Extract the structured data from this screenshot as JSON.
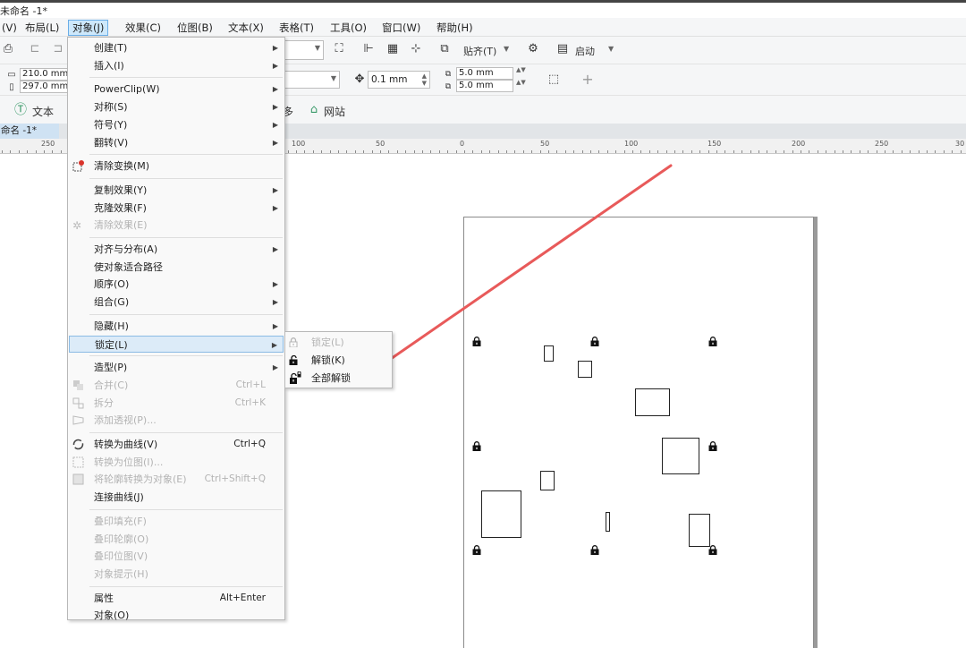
{
  "window": {
    "title": "未命名 -1*"
  },
  "menubar": {
    "items": [
      "(V)",
      "布局(L)",
      "对象(J)",
      "效果(C)",
      "位图(B)",
      "文本(X)",
      "表格(T)",
      "工具(O)",
      "窗口(W)",
      "帮助(H)"
    ]
  },
  "toolbar1": {
    "snap_label": "贴齐(T)",
    "launch_label": "启动"
  },
  "toolbar2": {
    "width": "210.0 mm",
    "height": "297.0 mm",
    "nudge": "0.1 mm",
    "dup_x": "5.0 mm",
    "dup_y": "5.0 mm"
  },
  "toolbar3": {
    "text_label": "文本",
    "website_label": "网站",
    "partial_char": "多"
  },
  "document_tab": {
    "label": "命名 -1*"
  },
  "ruler": {
    "labels": [
      "250",
      "100",
      "50",
      "0",
      "50",
      "100",
      "150",
      "200",
      "250",
      "30"
    ]
  },
  "object_menu": {
    "groups": [
      [
        {
          "label": "创建(T)",
          "submenu": true
        },
        {
          "label": "插入(I)",
          "submenu": true
        }
      ],
      [
        {
          "label": "PowerClip(W)",
          "submenu": true
        },
        {
          "label": "对称(S)",
          "submenu": true
        },
        {
          "label": "符号(Y)",
          "submenu": true
        },
        {
          "label": "翻转(V)",
          "submenu": true
        }
      ],
      [
        {
          "label": "清除变换(M)",
          "icon": "clear-transform-icon"
        }
      ],
      [
        {
          "label": "复制效果(Y)",
          "submenu": true
        },
        {
          "label": "克隆效果(F)",
          "submenu": true
        },
        {
          "label": "清除效果(E)",
          "disabled": true,
          "icon": "clear-effect-icon"
        }
      ],
      [
        {
          "label": "对齐与分布(A)",
          "submenu": true
        },
        {
          "label": "使对象适合路径"
        },
        {
          "label": "顺序(O)",
          "submenu": true
        },
        {
          "label": "组合(G)",
          "submenu": true
        }
      ],
      [
        {
          "label": "隐藏(H)",
          "submenu": true
        },
        {
          "label": "锁定(L)",
          "submenu": true,
          "highlighted": true
        }
      ],
      [
        {
          "label": "造型(P)",
          "submenu": true
        },
        {
          "label": "合并(C)",
          "shortcut": "Ctrl+L",
          "disabled": true,
          "icon": "combine-icon"
        },
        {
          "label": "拆分",
          "shortcut": "Ctrl+K",
          "disabled": true,
          "icon": "break-apart-icon"
        },
        {
          "label": "添加透视(P)...",
          "disabled": true,
          "icon": "perspective-icon"
        }
      ],
      [
        {
          "label": "转换为曲线(V)",
          "shortcut": "Ctrl+Q",
          "icon": "convert-curves-icon"
        },
        {
          "label": "转换为位图(I)...",
          "disabled": true,
          "icon": "convert-bitmap-icon"
        },
        {
          "label": "将轮廓转换为对象(E)",
          "shortcut": "Ctrl+Shift+Q",
          "disabled": true,
          "icon": "outline-object-icon"
        },
        {
          "label": "连接曲线(J)"
        }
      ],
      [
        {
          "label": "叠印填充(F)",
          "disabled": true
        },
        {
          "label": "叠印轮廓(O)",
          "disabled": true
        },
        {
          "label": "叠印位图(V)",
          "disabled": true
        },
        {
          "label": "对象提示(H)",
          "disabled": true
        }
      ],
      [
        {
          "label": "属性",
          "shortcut": "Alt+Enter"
        },
        {
          "label": "对象(O)"
        }
      ]
    ]
  },
  "lock_submenu": {
    "items": [
      {
        "label": "锁定(L)",
        "disabled": true,
        "icon": "lock-icon"
      },
      {
        "label": "解锁(K)",
        "icon": "unlock-icon"
      },
      {
        "label": "全部解锁",
        "icon": "unlock-all-icon"
      }
    ]
  },
  "colors": {
    "arrow": "#e85a5a",
    "menu_highlight": "#dcebf8",
    "menubar_active": "#cde8fb"
  }
}
